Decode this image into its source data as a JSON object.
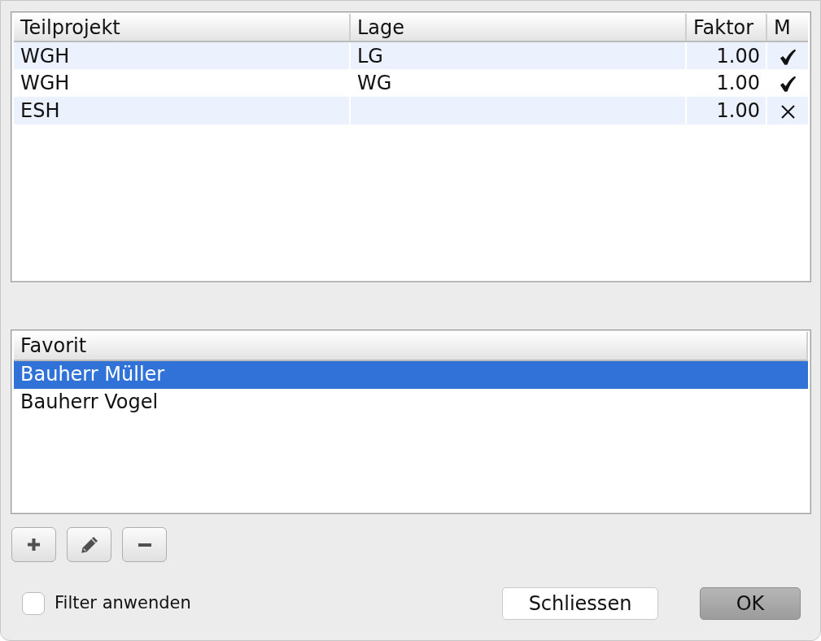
{
  "table": {
    "columns": [
      {
        "label": "Teilprojekt",
        "kind": "text"
      },
      {
        "label": "Lage",
        "kind": "text"
      },
      {
        "label": "Faktor",
        "kind": "number"
      },
      {
        "label": "M",
        "kind": "mark"
      }
    ],
    "rows": [
      {
        "project": "WGH",
        "location": "LG",
        "factor": "1.00",
        "marked": true,
        "selected": false
      },
      {
        "project": "WGH",
        "location": "WG",
        "factor": "1.00",
        "marked": true,
        "selected": false
      },
      {
        "project": "ESH",
        "factor": "1.00",
        "marked": false,
        "selected": false
      }
    ]
  },
  "favorites": {
    "header": "Favorit",
    "items": [
      {
        "label": "Bauherr Müller",
        "selected": true
      },
      {
        "label": "Bauherr Vogel",
        "selected": false
      }
    ]
  },
  "list_tools": [
    {
      "kind": "add"
    },
    {
      "kind": "edit"
    },
    {
      "kind": "remove"
    }
  ],
  "filter": {
    "label": "Filter anwenden",
    "checked": false
  },
  "buttons": [
    {
      "label": "Schliessen",
      "default": false
    },
    {
      "label": "OK",
      "default": true
    }
  ]
}
